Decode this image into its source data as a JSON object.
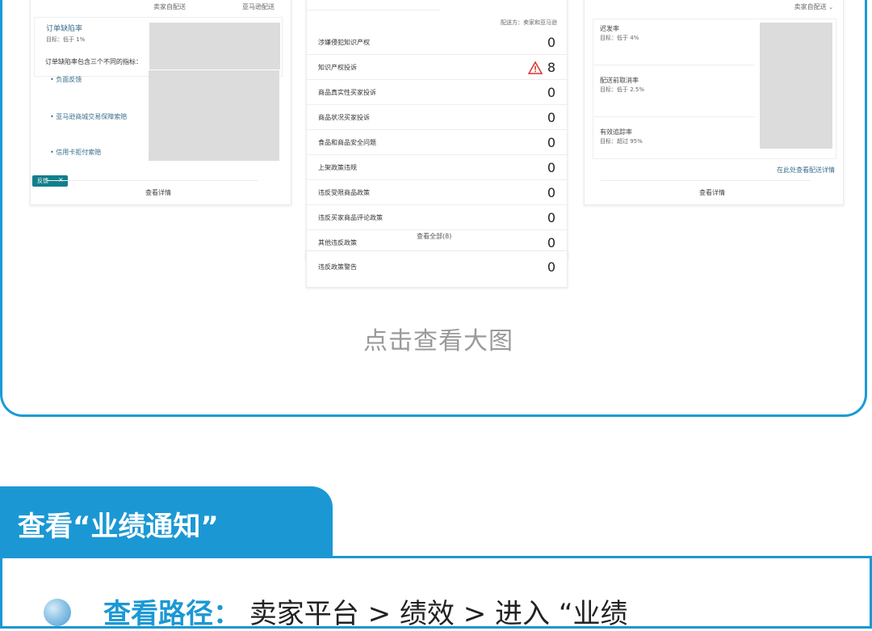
{
  "screenshot": {
    "left_card": {
      "tabs": [
        "卖家自配送",
        "亚马逊配送"
      ],
      "metric_title": "订单缺陷率",
      "metric_target": "目标：低于 1%",
      "breakdown_title": "订单缺陷率包含三个不同的指标：",
      "breakdown_items": [
        "负面反馈",
        "亚马逊商城交易保障索赔",
        "信用卡拒付索赔"
      ],
      "badge": "反馈",
      "badge_close": "×",
      "details_link": "查看详情"
    },
    "middle_card": {
      "fulfilled_by": "配送方：卖家和亚马逊",
      "rows": [
        {
          "label": "涉嫌侵犯知识产权",
          "value": "0"
        },
        {
          "label": "知识产权投诉",
          "value": "8",
          "warning": true
        },
        {
          "label": "商品真实性买家投诉",
          "value": "0"
        },
        {
          "label": "商品状况买家投诉",
          "value": "0"
        },
        {
          "label": "食品和商品安全问题",
          "value": "0"
        },
        {
          "label": "上架政策违规",
          "value": "0"
        },
        {
          "label": "违反受限商品政策",
          "value": "0"
        },
        {
          "label": "违反买家商品评论政策",
          "value": "0"
        },
        {
          "label": "其他违反政策",
          "value": "0"
        }
      ],
      "view_all": "查看全部(8)",
      "warnings_label": "违反政策警告",
      "warnings_value": "0"
    },
    "right_card": {
      "dropdown": "卖家自配送",
      "metrics": [
        {
          "title": "迟发率",
          "target": "目标：低于 4%"
        },
        {
          "title": "配送前取消率",
          "target": "目标：低于 2.5%"
        },
        {
          "title": "有效追踪率",
          "target": "目标：超过 95%"
        }
      ],
      "delivery_link": "在此处查看配送详情",
      "details_link": "查看详情"
    },
    "bar_colors": [
      "#c0235a",
      "#e8c21e",
      "#6aa82e"
    ],
    "highlight_color": "#e0282c"
  },
  "caption": "点击查看大图",
  "section_title": "查看“业绩通知”",
  "path": {
    "label": "查看路径：",
    "text": "卖家平台 > 绩效 > 进入 “业绩"
  },
  "colors": {
    "accent": "#1b98d4",
    "caption": "#9a9a9a"
  },
  "icons": [
    "warning-icon",
    "bullet-icon",
    "chevron-down-icon",
    "close-icon"
  ]
}
